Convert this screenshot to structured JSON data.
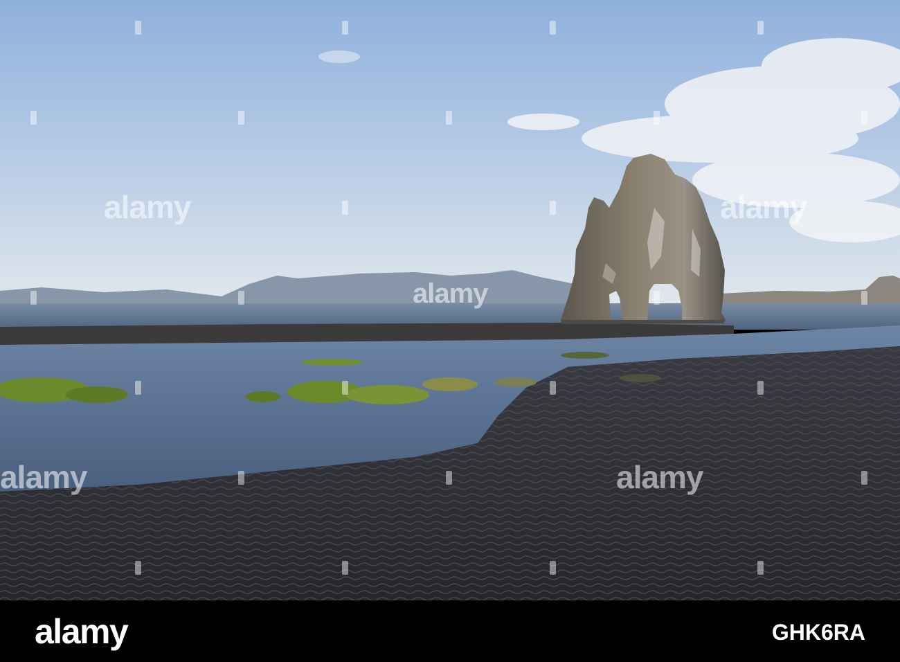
{
  "watermark": {
    "text": "alamy"
  },
  "footer": {
    "logo": "alamy",
    "image_code": "GHK6RA"
  },
  "colors": {
    "sky_top": "#8fb0dc",
    "sky_horizon": "#dfe6ec",
    "sea": "#5d6f86",
    "sand": "#2c2b31",
    "rock": "#6f675c",
    "moss": "#6c8a2a",
    "footer": "#000000"
  }
}
